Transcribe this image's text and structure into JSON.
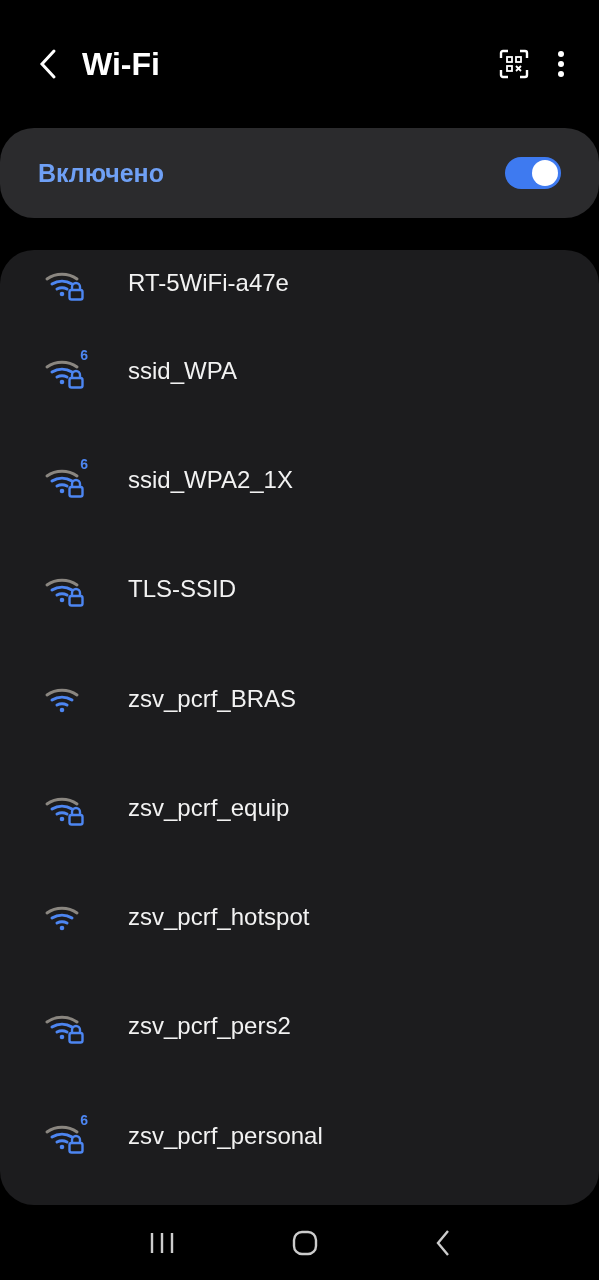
{
  "header": {
    "title": "Wi-Fi"
  },
  "master_switch": {
    "label": "Включено",
    "on": true
  },
  "networks": [
    {
      "name": "RT-5WiFi-a47e",
      "locked": true
    },
    {
      "name": "ssid_WPA",
      "locked": true,
      "badge": "6"
    },
    {
      "name": "ssid_WPA2_1X",
      "locked": true,
      "badge": "6"
    },
    {
      "name": "TLS-SSID",
      "locked": true
    },
    {
      "name": "zsv_pcrf_BRAS",
      "locked": false
    },
    {
      "name": "zsv_pcrf_equip",
      "locked": true
    },
    {
      "name": "zsv_pcrf_hotspot",
      "locked": false
    },
    {
      "name": "zsv_pcrf_pers2",
      "locked": true
    },
    {
      "name": "zsv_pcrf_personal",
      "locked": true,
      "badge": "6"
    }
  ]
}
